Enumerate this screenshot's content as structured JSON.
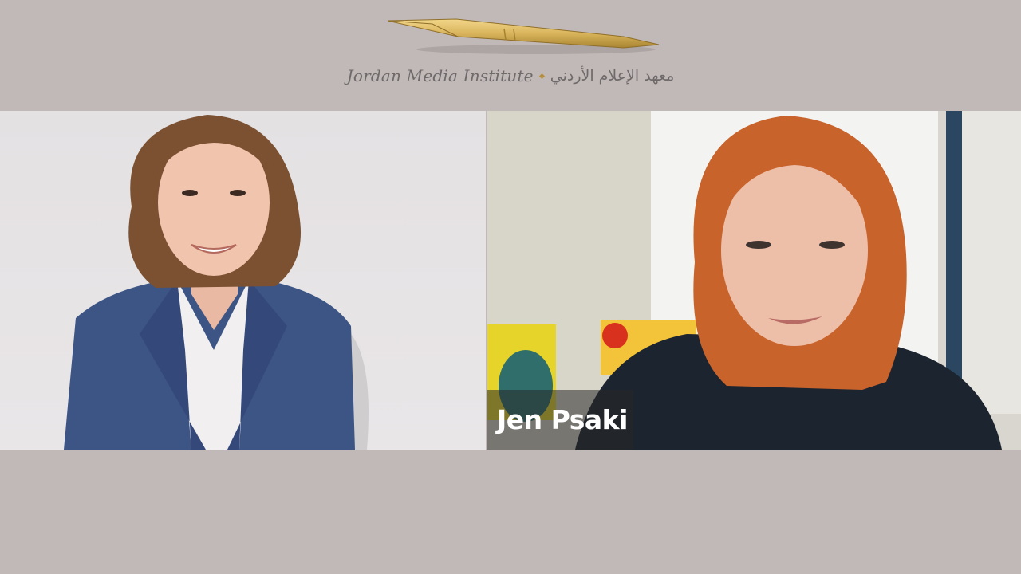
{
  "header": {
    "brand_en": "Jordan Media Institute",
    "brand_ar": "معهد الإعلام الأردني"
  },
  "participants": [
    {
      "position": "left",
      "label": ""
    },
    {
      "position": "right",
      "label": "Jen Psaki"
    }
  ],
  "colors": {
    "background": "#c1b8b8",
    "logo_gold": "#d9b45c",
    "brand_text": "#6f6a6a"
  }
}
